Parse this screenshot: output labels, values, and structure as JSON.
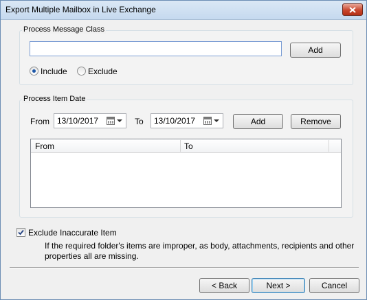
{
  "window": {
    "title": "Export Multiple Mailbox in Live Exchange"
  },
  "message_class": {
    "group_title": "Process Message Class",
    "input_value": "",
    "add_label": "Add",
    "include_label": "Include",
    "exclude_label": "Exclude",
    "selected": "Include"
  },
  "item_date": {
    "group_title": "Process Item Date",
    "from_label": "From",
    "from_value": "13/10/2017",
    "to_label": "To",
    "to_value": "13/10/2017",
    "add_label": "Add",
    "remove_label": "Remove",
    "columns": [
      "From",
      "To"
    ],
    "rows": []
  },
  "exclude_inaccurate": {
    "label": "Exclude Inaccurate Item",
    "checked": true,
    "description": "If the required folder's items are improper, as body, attachments, recipients and other properties all are missing."
  },
  "footer": {
    "back_label": "< Back",
    "next_label": "Next >",
    "cancel_label": "Cancel"
  },
  "icons": [
    "close-icon",
    "calendar-icon",
    "chevron-down-icon",
    "checkmark-icon"
  ]
}
